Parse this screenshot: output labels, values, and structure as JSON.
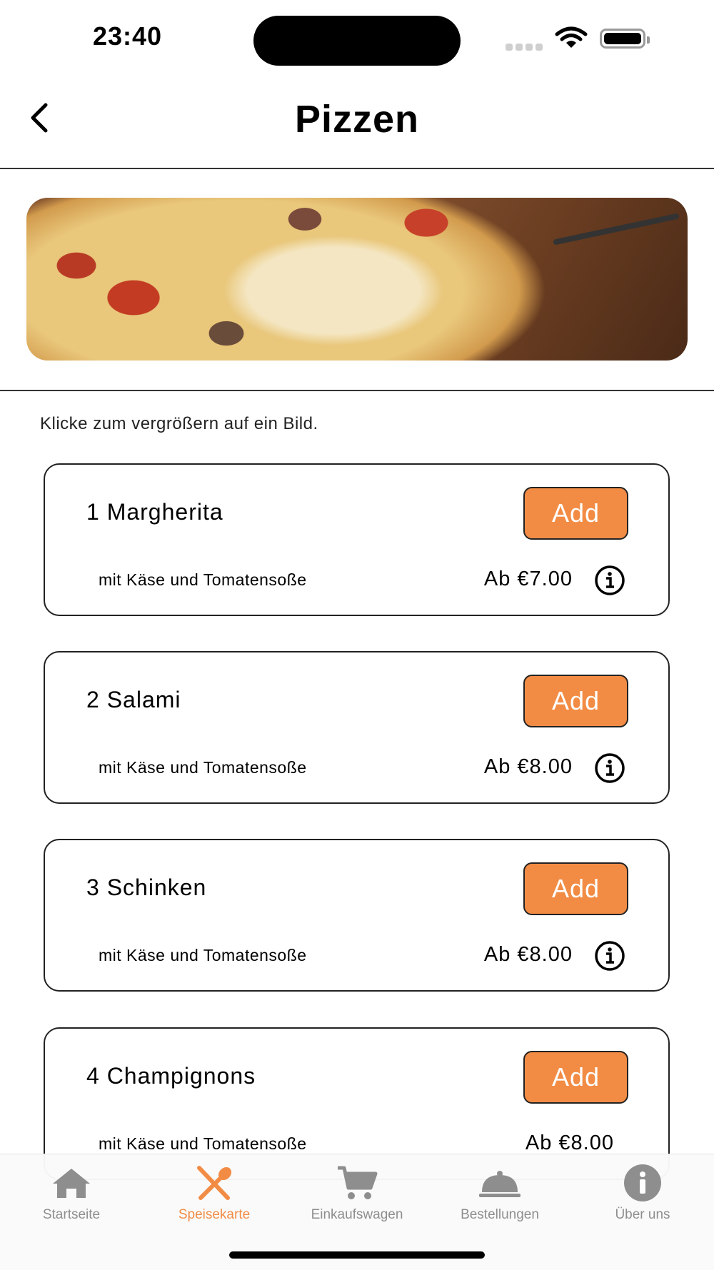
{
  "status_bar": {
    "time": "23:40"
  },
  "nav": {
    "title": "Pizzen"
  },
  "hint": "Klicke zum vergrößern auf ein Bild.",
  "items": [
    {
      "name": "1 Margherita",
      "description": "mit Käse und Tomatensoße",
      "price": "Ab €7.00",
      "add_label": "Add"
    },
    {
      "name": "2 Salami",
      "description": "mit Käse und Tomatensoße",
      "price": "Ab €8.00",
      "add_label": "Add"
    },
    {
      "name": "3 Schinken",
      "description": "mit Käse und Tomatensoße",
      "price": "Ab €8.00",
      "add_label": "Add"
    },
    {
      "name": "4 Champignons",
      "description": "mit Käse und Tomatensoße",
      "price": "Ab €8.00",
      "add_label": "Add"
    }
  ],
  "tabs": [
    {
      "label": "Startseite",
      "icon": "house-icon"
    },
    {
      "label": "Speisekarte",
      "icon": "spoon-knife-icon"
    },
    {
      "label": "Einkaufswagen",
      "icon": "cart-icon"
    },
    {
      "label": "Bestellungen",
      "icon": "cloche-icon"
    },
    {
      "label": "Über uns",
      "icon": "info-icon"
    }
  ],
  "colors": {
    "accent": "#f28c45",
    "inactive": "#8e8e8e"
  }
}
